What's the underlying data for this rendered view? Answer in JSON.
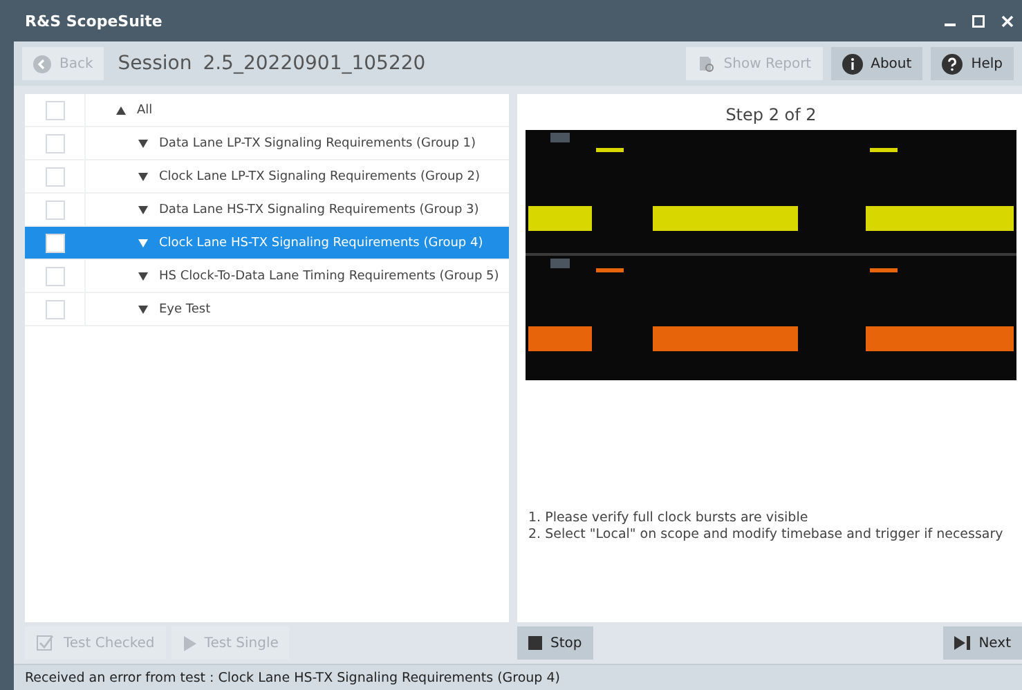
{
  "window": {
    "title": "R&S ScopeSuite"
  },
  "toolbar": {
    "back": {
      "label": "Back",
      "disabled": true
    },
    "session_label": "Session",
    "session_name": "2.5_20220901_105220",
    "buttons": [
      {
        "kind": "report",
        "label": "Show Report",
        "disabled": true
      },
      {
        "kind": "about",
        "label": "About",
        "disabled": false
      },
      {
        "kind": "help",
        "label": "Help",
        "disabled": false
      }
    ]
  },
  "tree": [
    {
      "label": "All",
      "expanded": true,
      "checked": false,
      "selected": false,
      "children": [
        {
          "label": "Data Lane LP-TX Signaling Requirements (Group 1)",
          "expanded": false,
          "checked": false,
          "selected": false
        },
        {
          "label": "Clock Lane LP-TX Signaling Requirements (Group 2)",
          "expanded": false,
          "checked": false,
          "selected": false
        },
        {
          "label": "Data Lane HS-TX Signaling Requirements (Group 3)",
          "expanded": false,
          "checked": false,
          "selected": false
        },
        {
          "label": "Clock Lane HS-TX Signaling Requirements (Group 4)",
          "expanded": false,
          "checked": false,
          "selected": true
        },
        {
          "label": "HS Clock-To-Data Lane Timing Requirements (Group 5)",
          "expanded": false,
          "checked": false,
          "selected": false
        },
        {
          "label": "Eye Test",
          "expanded": false,
          "checked": false,
          "selected": false
        }
      ]
    }
  ],
  "step": {
    "title": "Step 2 of 2",
    "image": {
      "kind": "picture"
    },
    "instructions": [
      "1. Please verify full clock bursts are visible",
      "2. Select \"Local\" on scope and modify timebase and trigger if necessary"
    ]
  },
  "left_actions": [
    {
      "kind": "check",
      "label": "Test Checked",
      "disabled": true
    },
    {
      "kind": "play",
      "label": "Test Single",
      "disabled": true
    }
  ],
  "right_actions": [
    {
      "kind": "stop",
      "label": "Stop",
      "disabled": false
    },
    {
      "kind": "next",
      "label": "Next",
      "disabled": false
    }
  ],
  "status_bar": "Received an error from test : Clock Lane HS-TX Signaling Requirements (Group 4)"
}
